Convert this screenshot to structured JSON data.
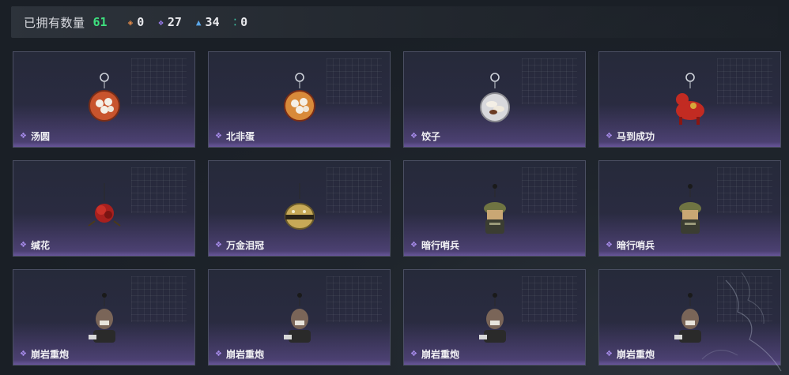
{
  "header": {
    "owned_label": "已拥有数量",
    "owned_count": "61",
    "stats": [
      {
        "icon": "orange-diamond-icon",
        "color": "#e08a4a",
        "glyph": "◈",
        "value": "0"
      },
      {
        "icon": "purple-diamond-icon",
        "color": "#9b7df0",
        "glyph": "❖",
        "value": "27"
      },
      {
        "icon": "blue-triangle-icon",
        "color": "#5aa6e8",
        "glyph": "▲",
        "value": "34"
      },
      {
        "icon": "green-dots-icon",
        "color": "#3ec7a8",
        "glyph": "⁚",
        "value": "0"
      }
    ]
  },
  "items": [
    {
      "name": "汤圆",
      "charm": "bowl",
      "color": "#c8542d"
    },
    {
      "name": "北非蛋",
      "charm": "bowl",
      "color": "#d88a3a"
    },
    {
      "name": "饺子",
      "charm": "plate",
      "color": "#c9c9c9"
    },
    {
      "name": "马到成功",
      "charm": "horse",
      "color": "#c22b22"
    },
    {
      "name": "缄花",
      "charm": "flower",
      "color": "#a8201e"
    },
    {
      "name": "万金泪冠",
      "charm": "crown",
      "color": "#c7a957"
    },
    {
      "name": "暗行哨兵",
      "charm": "soldier",
      "color": "#6f7442"
    },
    {
      "name": "暗行哨兵",
      "charm": "soldier",
      "color": "#6f7442"
    },
    {
      "name": "崩岩重炮",
      "charm": "gunner",
      "color": "#7a6558"
    },
    {
      "name": "崩岩重炮",
      "charm": "gunner",
      "color": "#7a6558"
    },
    {
      "name": "崩岩重炮",
      "charm": "gunner",
      "color": "#7a6558"
    },
    {
      "name": "崩岩重炮",
      "charm": "gunner",
      "color": "#7a6558"
    }
  ]
}
